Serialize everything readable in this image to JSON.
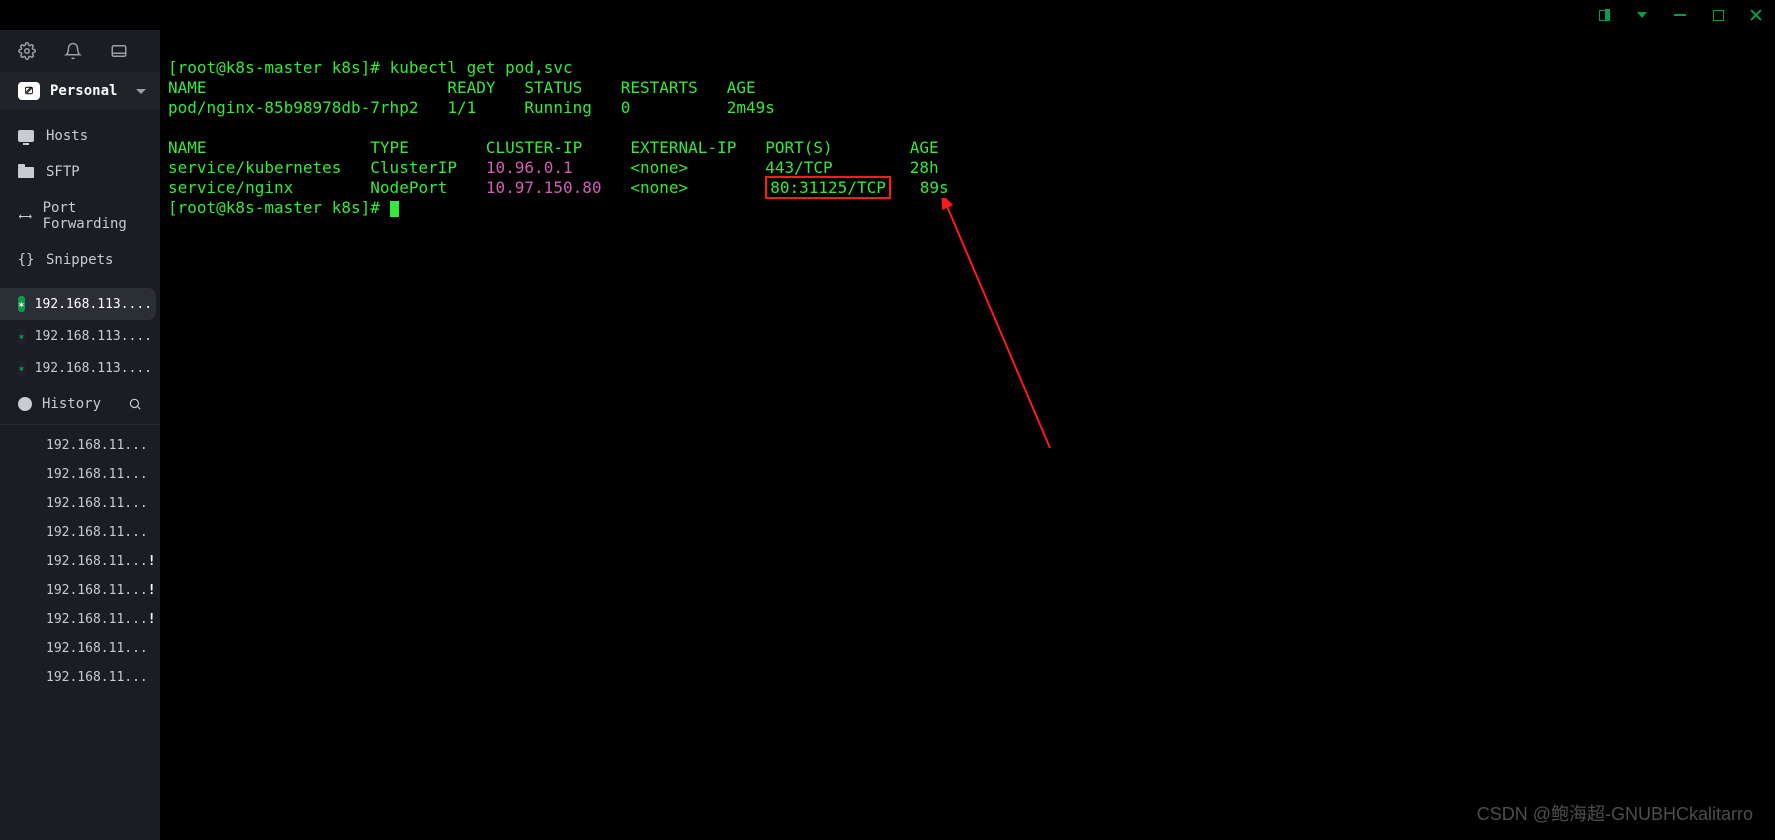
{
  "titlebar": {
    "split": "split-panel",
    "dropdown": "dropdown",
    "minimize": "minimize",
    "maximize": "maximize",
    "close": "close"
  },
  "sidebar": {
    "personal_label": "Personal",
    "nav": [
      {
        "icon": "hosts",
        "label": "Hosts"
      },
      {
        "icon": "folder",
        "label": "SFTP"
      },
      {
        "icon": "port",
        "label": "Port Forwarding"
      },
      {
        "icon": "braces",
        "label": "Snippets"
      }
    ],
    "sessions": [
      {
        "label": "192.168.113....",
        "active": true
      },
      {
        "label": "192.168.113....",
        "active": false
      },
      {
        "label": "192.168.113....",
        "active": false
      }
    ],
    "history_label": "History",
    "history": [
      {
        "label": "192.168.11...",
        "alert": false
      },
      {
        "label": "192.168.11...",
        "alert": false
      },
      {
        "label": "192.168.11...",
        "alert": false
      },
      {
        "label": "192.168.11...",
        "alert": false
      },
      {
        "label": "192.168.11...",
        "alert": true
      },
      {
        "label": "192.168.11...",
        "alert": true
      },
      {
        "label": "192.168.11...",
        "alert": true
      },
      {
        "label": "192.168.11...",
        "alert": false
      },
      {
        "label": "192.168.11...",
        "alert": false
      }
    ]
  },
  "terminal": {
    "prompt1": "[root@k8s-master k8s]# ",
    "command1": "kubectl get pod,svc",
    "pod_header": "NAME                         READY   STATUS    RESTARTS   AGE",
    "pod_row": "pod/nginx-85b98978db-7rhp2   1/1     Running   0          2m49s",
    "svc_header": "NAME                 TYPE        CLUSTER-IP     EXTERNAL-IP   PORT(S)        AGE",
    "svc_row1_pre": "service/kubernetes   ClusterIP   ",
    "svc_row1_ip": "10.96.0.1",
    "svc_row1_post": "      <none>        443/TCP        28h",
    "svc_row2_pre": "service/nginx        NodePort    ",
    "svc_row2_ip": "10.97.150.80",
    "svc_row2_mid": "   <none>        ",
    "svc_row2_port": "80:31125/TCP",
    "svc_row2_post": "   89s",
    "prompt2": "[root@k8s-master k8s]# "
  },
  "watermark": "CSDN @鲍海超-GNUBHCkalitarro"
}
